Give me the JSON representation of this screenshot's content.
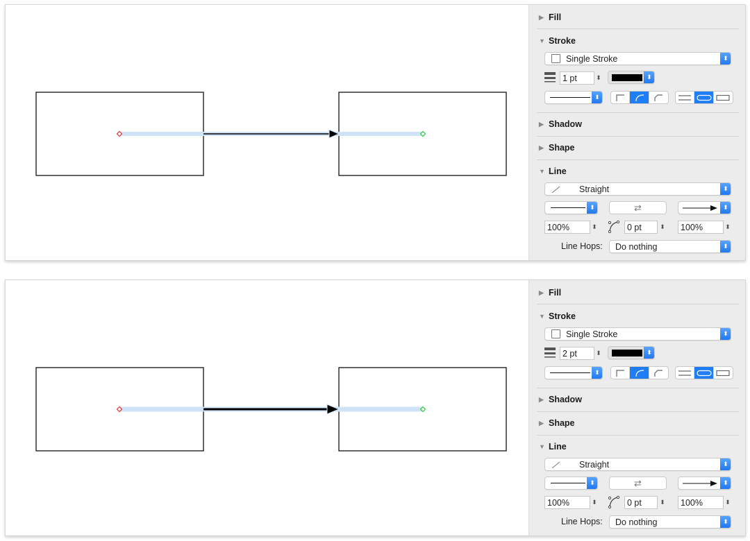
{
  "colors": {
    "accent": "#1f7df5",
    "selection_highlight": "#cfe3f7",
    "start_point": "#e53935",
    "end_point": "#2ecc40",
    "panel_bg": "#ececec"
  },
  "windows": [
    {
      "canvas": {
        "shapes": [
          {
            "type": "rectangle",
            "label": "left-box"
          },
          {
            "type": "rectangle",
            "label": "right-box"
          }
        ],
        "connector": {
          "type": "straight-arrow",
          "stroke_weight_pt": 1,
          "selected": true
        }
      },
      "inspector": {
        "fill": {
          "title": "Fill",
          "expanded": false
        },
        "stroke": {
          "title": "Stroke",
          "expanded": true,
          "type_label": "Single Stroke",
          "weight": "1 pt",
          "color": "#000000",
          "corner_style_selected": 1,
          "cap_style_selected": 1
        },
        "shadow": {
          "title": "Shadow",
          "expanded": false
        },
        "shape": {
          "title": "Shape",
          "expanded": false
        },
        "line": {
          "title": "Line",
          "expanded": true,
          "type_label": "Straight",
          "tail_scale": "100%",
          "bezier_offset": "0 pt",
          "head_scale": "100%",
          "swap_icon": "⇄",
          "line_hops_label": "Line Hops:",
          "line_hops_value": "Do nothing"
        }
      }
    },
    {
      "canvas": {
        "shapes": [
          {
            "type": "rectangle",
            "label": "left-box"
          },
          {
            "type": "rectangle",
            "label": "right-box"
          }
        ],
        "connector": {
          "type": "straight-arrow",
          "stroke_weight_pt": 2,
          "selected": true
        }
      },
      "inspector": {
        "fill": {
          "title": "Fill",
          "expanded": false
        },
        "stroke": {
          "title": "Stroke",
          "expanded": true,
          "type_label": "Single Stroke",
          "weight": "2 pt",
          "color": "#000000",
          "corner_style_selected": 1,
          "cap_style_selected": 1
        },
        "shadow": {
          "title": "Shadow",
          "expanded": false
        },
        "shape": {
          "title": "Shape",
          "expanded": false
        },
        "line": {
          "title": "Line",
          "expanded": true,
          "type_label": "Straight",
          "tail_scale": "100%",
          "bezier_offset": "0 pt",
          "head_scale": "100%",
          "swap_icon": "⇄",
          "line_hops_label": "Line Hops:",
          "line_hops_value": "Do nothing"
        }
      }
    }
  ],
  "icons": {
    "collapsed": "▶",
    "expanded": "▼",
    "popup_arrows": "⌃⌄",
    "stepper": "⇕"
  }
}
